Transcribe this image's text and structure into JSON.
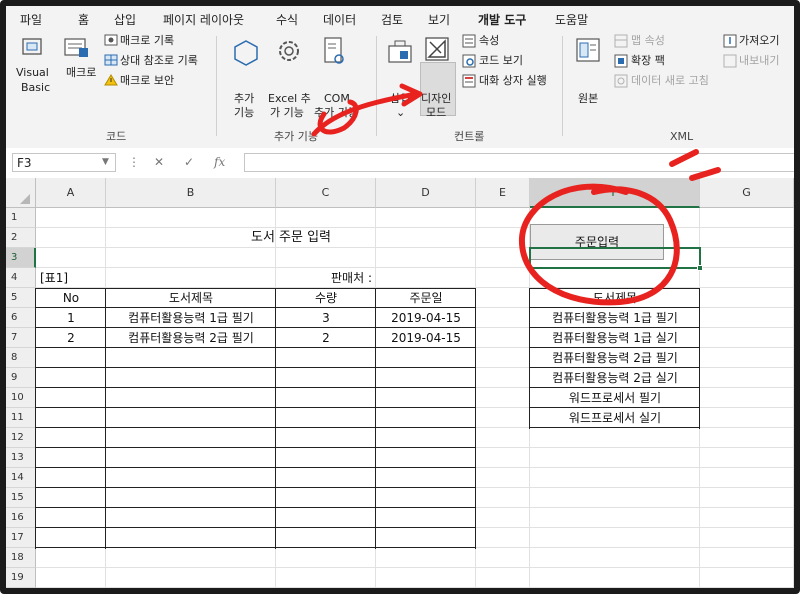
{
  "ribbon_tabs": [
    "파일",
    "홈",
    "삽입",
    "페이지 레이아웃",
    "수식",
    "데이터",
    "검토",
    "보기",
    "개발 도구",
    "도움말"
  ],
  "active_tab": "개발 도구",
  "code_group": {
    "visual_basic_line1": "Visual",
    "visual_basic_line2": "Basic",
    "macro": "매크로",
    "record_macro": "매크로 기록",
    "relative_ref": "상대 참조로 기록",
    "macro_security": "매크로 보안",
    "group_label": "코드"
  },
  "addins_group": {
    "addins_line1": "추가",
    "addins_line2": "기능",
    "excel_addins_line1": "Excel 추",
    "excel_addins_line2": "가 기능",
    "com_addins_line1": "COM",
    "com_addins_line2": "추가 기능",
    "group_label": "추가 기능"
  },
  "controls_group": {
    "insert": "삽입",
    "design_mode_line1": "디자인",
    "design_mode_line2": "모드",
    "properties": "속성",
    "view_code": "코드 보기",
    "run_dialog": "대화 상자 실행",
    "group_label": "컨트롤"
  },
  "xml_group": {
    "source": "원본",
    "map_properties": "맵 속성",
    "expansion_packs": "확장 팩",
    "refresh_data": "데이터 새로 고침",
    "import": "가져오기",
    "export": "내보내기",
    "group_label": "XML"
  },
  "formula_bar": {
    "name_box": "F3",
    "fx": "fx",
    "value": ""
  },
  "columns": [
    "A",
    "B",
    "C",
    "D",
    "E",
    "F",
    "G"
  ],
  "selected_column": "F",
  "rows": [
    "1",
    "2",
    "3",
    "4",
    "5",
    "6",
    "7",
    "8",
    "9",
    "10",
    "11",
    "12",
    "13",
    "14",
    "15",
    "16",
    "17",
    "18",
    "19"
  ],
  "selected_row": "3",
  "sheet": {
    "title": "도서 주문 입력",
    "table_label": "[표1]",
    "seller_label": "판매처 :",
    "headers": [
      "No",
      "도서제목",
      "수량",
      "주문일"
    ],
    "rows": [
      [
        "1",
        "컴퓨터활용능력 1급 필기",
        "3",
        "2019-04-15"
      ],
      [
        "2",
        "컴퓨터활용능력 2급 필기",
        "2",
        "2019-04-15"
      ]
    ],
    "button_label": "주문입력",
    "list_header": "도서제목",
    "list_items": [
      "컴퓨터활용능력 1급 필기",
      "컴퓨터활용능력 1급 실기",
      "컴퓨터활용능력 2급 필기",
      "컴퓨터활용능력 2급 실기",
      "워드프로세서 필기",
      "워드프로세서 실기"
    ]
  },
  "colors": {
    "accent": "#217346",
    "annotation": "#e8231f"
  }
}
